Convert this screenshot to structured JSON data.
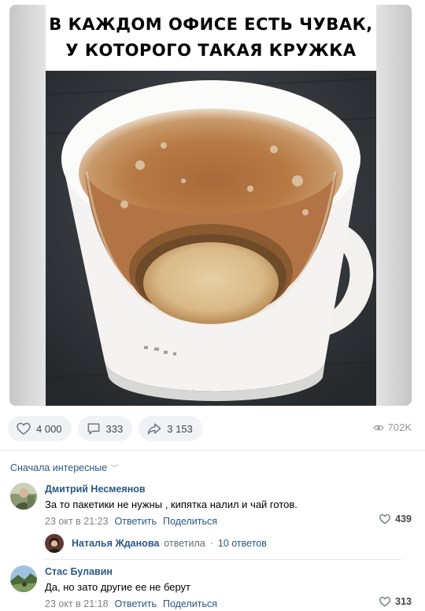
{
  "post": {
    "image": {
      "caption_line1": "В КАЖДОМ ОФИСЕ ЕСТЬ ЧУВАК,",
      "caption_line2": "У КОТОРОГО ТАКАЯ КРУЖКА"
    },
    "actions": {
      "likes": "4 000",
      "comments": "333",
      "shares": "3 153",
      "views": "702K"
    }
  },
  "comments": {
    "sort_label": "Сначала интересные",
    "items": [
      {
        "author": "Дмитрий Несмеянов",
        "text": "За то пакетики не нужны , кипятка налил и чай готов.",
        "date": "23 окт в 21:23",
        "reply_label": "Ответить",
        "share_label": "Поделиться",
        "likes": "439",
        "thread": {
          "name": "Наталья Жданова",
          "verb": "ответила",
          "separator": "·",
          "count": "10 ответов"
        }
      },
      {
        "author": "Стас Булавин",
        "text": "Да, но зато другие ее не берут",
        "date": "23 окт в 21:18",
        "reply_label": "Ответить",
        "share_label": "Поделиться",
        "likes": "313"
      }
    ]
  },
  "colors": {
    "link": "#2a5885",
    "button_bg": "#f0f2f5",
    "muted": "#828282"
  }
}
